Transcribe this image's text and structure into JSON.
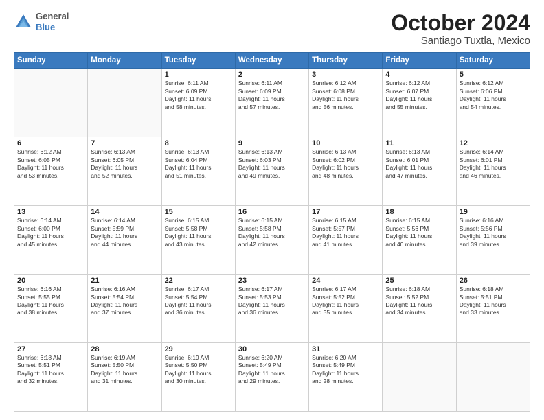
{
  "header": {
    "logo_line1": "General",
    "logo_line2": "Blue",
    "title": "October 2024",
    "subtitle": "Santiago Tuxtla, Mexico"
  },
  "weekdays": [
    "Sunday",
    "Monday",
    "Tuesday",
    "Wednesday",
    "Thursday",
    "Friday",
    "Saturday"
  ],
  "weeks": [
    [
      {
        "day": "",
        "info": ""
      },
      {
        "day": "",
        "info": ""
      },
      {
        "day": "1",
        "info": "Sunrise: 6:11 AM\nSunset: 6:09 PM\nDaylight: 11 hours\nand 58 minutes."
      },
      {
        "day": "2",
        "info": "Sunrise: 6:11 AM\nSunset: 6:09 PM\nDaylight: 11 hours\nand 57 minutes."
      },
      {
        "day": "3",
        "info": "Sunrise: 6:12 AM\nSunset: 6:08 PM\nDaylight: 11 hours\nand 56 minutes."
      },
      {
        "day": "4",
        "info": "Sunrise: 6:12 AM\nSunset: 6:07 PM\nDaylight: 11 hours\nand 55 minutes."
      },
      {
        "day": "5",
        "info": "Sunrise: 6:12 AM\nSunset: 6:06 PM\nDaylight: 11 hours\nand 54 minutes."
      }
    ],
    [
      {
        "day": "6",
        "info": "Sunrise: 6:12 AM\nSunset: 6:05 PM\nDaylight: 11 hours\nand 53 minutes."
      },
      {
        "day": "7",
        "info": "Sunrise: 6:13 AM\nSunset: 6:05 PM\nDaylight: 11 hours\nand 52 minutes."
      },
      {
        "day": "8",
        "info": "Sunrise: 6:13 AM\nSunset: 6:04 PM\nDaylight: 11 hours\nand 51 minutes."
      },
      {
        "day": "9",
        "info": "Sunrise: 6:13 AM\nSunset: 6:03 PM\nDaylight: 11 hours\nand 49 minutes."
      },
      {
        "day": "10",
        "info": "Sunrise: 6:13 AM\nSunset: 6:02 PM\nDaylight: 11 hours\nand 48 minutes."
      },
      {
        "day": "11",
        "info": "Sunrise: 6:13 AM\nSunset: 6:01 PM\nDaylight: 11 hours\nand 47 minutes."
      },
      {
        "day": "12",
        "info": "Sunrise: 6:14 AM\nSunset: 6:01 PM\nDaylight: 11 hours\nand 46 minutes."
      }
    ],
    [
      {
        "day": "13",
        "info": "Sunrise: 6:14 AM\nSunset: 6:00 PM\nDaylight: 11 hours\nand 45 minutes."
      },
      {
        "day": "14",
        "info": "Sunrise: 6:14 AM\nSunset: 5:59 PM\nDaylight: 11 hours\nand 44 minutes."
      },
      {
        "day": "15",
        "info": "Sunrise: 6:15 AM\nSunset: 5:58 PM\nDaylight: 11 hours\nand 43 minutes."
      },
      {
        "day": "16",
        "info": "Sunrise: 6:15 AM\nSunset: 5:58 PM\nDaylight: 11 hours\nand 42 minutes."
      },
      {
        "day": "17",
        "info": "Sunrise: 6:15 AM\nSunset: 5:57 PM\nDaylight: 11 hours\nand 41 minutes."
      },
      {
        "day": "18",
        "info": "Sunrise: 6:15 AM\nSunset: 5:56 PM\nDaylight: 11 hours\nand 40 minutes."
      },
      {
        "day": "19",
        "info": "Sunrise: 6:16 AM\nSunset: 5:56 PM\nDaylight: 11 hours\nand 39 minutes."
      }
    ],
    [
      {
        "day": "20",
        "info": "Sunrise: 6:16 AM\nSunset: 5:55 PM\nDaylight: 11 hours\nand 38 minutes."
      },
      {
        "day": "21",
        "info": "Sunrise: 6:16 AM\nSunset: 5:54 PM\nDaylight: 11 hours\nand 37 minutes."
      },
      {
        "day": "22",
        "info": "Sunrise: 6:17 AM\nSunset: 5:54 PM\nDaylight: 11 hours\nand 36 minutes."
      },
      {
        "day": "23",
        "info": "Sunrise: 6:17 AM\nSunset: 5:53 PM\nDaylight: 11 hours\nand 36 minutes."
      },
      {
        "day": "24",
        "info": "Sunrise: 6:17 AM\nSunset: 5:52 PM\nDaylight: 11 hours\nand 35 minutes."
      },
      {
        "day": "25",
        "info": "Sunrise: 6:18 AM\nSunset: 5:52 PM\nDaylight: 11 hours\nand 34 minutes."
      },
      {
        "day": "26",
        "info": "Sunrise: 6:18 AM\nSunset: 5:51 PM\nDaylight: 11 hours\nand 33 minutes."
      }
    ],
    [
      {
        "day": "27",
        "info": "Sunrise: 6:18 AM\nSunset: 5:51 PM\nDaylight: 11 hours\nand 32 minutes."
      },
      {
        "day": "28",
        "info": "Sunrise: 6:19 AM\nSunset: 5:50 PM\nDaylight: 11 hours\nand 31 minutes."
      },
      {
        "day": "29",
        "info": "Sunrise: 6:19 AM\nSunset: 5:50 PM\nDaylight: 11 hours\nand 30 minutes."
      },
      {
        "day": "30",
        "info": "Sunrise: 6:20 AM\nSunset: 5:49 PM\nDaylight: 11 hours\nand 29 minutes."
      },
      {
        "day": "31",
        "info": "Sunrise: 6:20 AM\nSunset: 5:49 PM\nDaylight: 11 hours\nand 28 minutes."
      },
      {
        "day": "",
        "info": ""
      },
      {
        "day": "",
        "info": ""
      }
    ]
  ]
}
